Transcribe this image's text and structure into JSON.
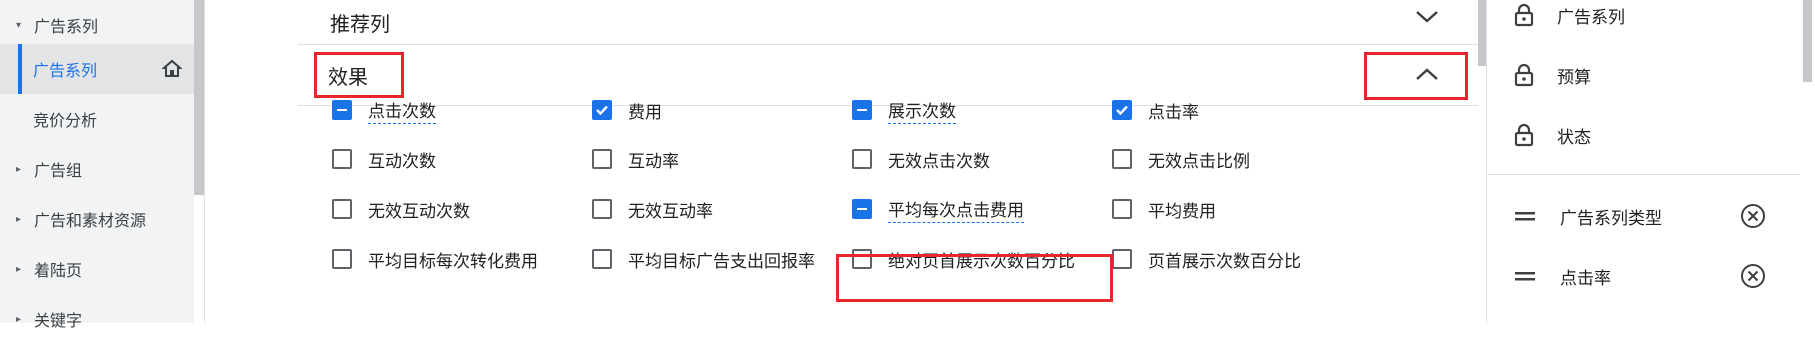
{
  "nav": {
    "items": [
      {
        "label": "广告系列",
        "arrow": "▾"
      },
      {
        "label": "广告系列"
      },
      {
        "label": "竞价分析"
      },
      {
        "label": "广告组",
        "arrow": "▸"
      },
      {
        "label": "广告和素材资源",
        "arrow": "▸"
      },
      {
        "label": "着陆页",
        "arrow": "▸"
      },
      {
        "label": "关键字",
        "arrow": "▸"
      }
    ]
  },
  "sections": {
    "recommended_title": "推荐列",
    "effect_title": "效果"
  },
  "metrics": [
    [
      {
        "label": "点击次数",
        "state": "partial",
        "dotted": true
      },
      {
        "label": "费用",
        "state": "checked"
      },
      {
        "label": "展示次数",
        "state": "partial",
        "dotted": true
      },
      {
        "label": "点击率",
        "state": "checked"
      }
    ],
    [
      {
        "label": "互动次数",
        "state": "unchecked"
      },
      {
        "label": "互动率",
        "state": "unchecked"
      },
      {
        "label": "无效点击次数",
        "state": "unchecked"
      },
      {
        "label": "无效点击比例",
        "state": "unchecked"
      }
    ],
    [
      {
        "label": "无效互动次数",
        "state": "unchecked"
      },
      {
        "label": "无效互动率",
        "state": "unchecked"
      },
      {
        "label": "平均每次点击费用",
        "state": "partial",
        "dotted": true
      },
      {
        "label": "平均费用",
        "state": "unchecked"
      }
    ],
    [
      {
        "label": "平均目标每次转化费用",
        "state": "unchecked"
      },
      {
        "label": "平均目标广告支出回报率",
        "state": "unchecked"
      },
      {
        "label": "绝对页首展示次数百分比",
        "state": "unchecked"
      },
      {
        "label": "页首展示次数百分比",
        "state": "unchecked"
      }
    ]
  ],
  "selected_columns": {
    "locked": [
      "广告系列",
      "预算",
      "状态"
    ],
    "removable": [
      "广告系列类型",
      "点击率"
    ]
  },
  "colors": {
    "accent": "#1a73e8",
    "highlight": "#e8272d"
  }
}
